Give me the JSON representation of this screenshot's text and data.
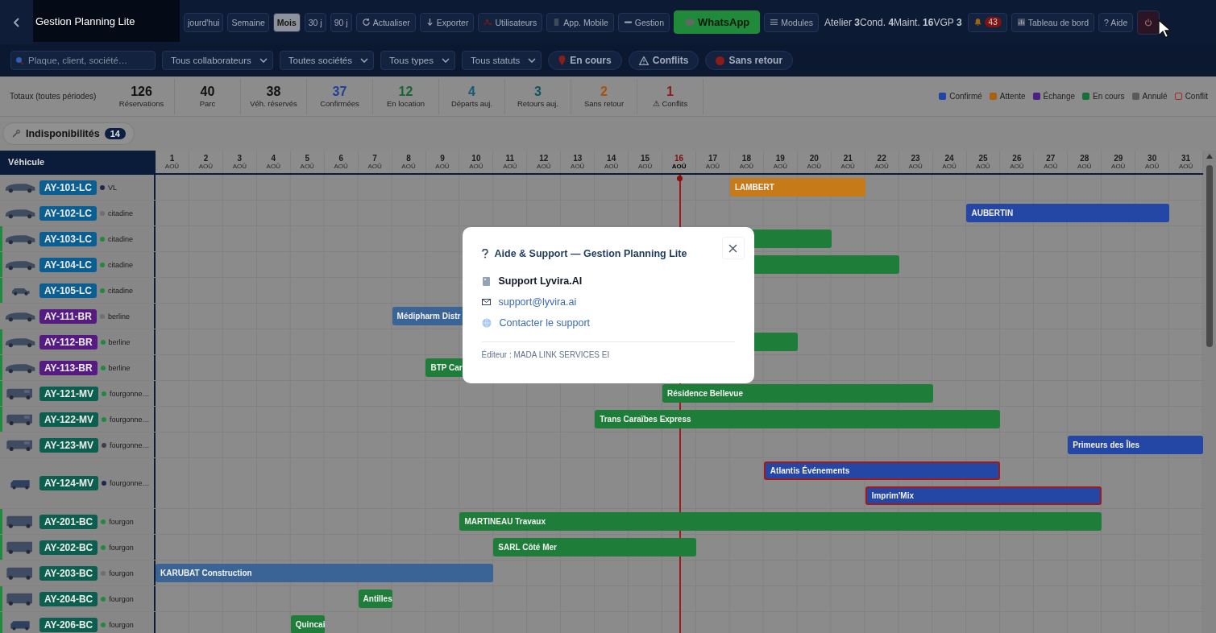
{
  "app": {
    "title": "Gestion Planning Lite"
  },
  "toolbar": {
    "views": [
      {
        "label": "jourd'hui",
        "selected": false
      },
      {
        "label": "Semaine",
        "selected": false
      },
      {
        "label": "Mois",
        "selected": true
      },
      {
        "label": "30 j",
        "selected": false
      },
      {
        "label": "90 j",
        "selected": false
      }
    ],
    "actions": [
      {
        "kind": "refresh",
        "label": "Actualiser"
      },
      {
        "kind": "export",
        "label": "Exporter"
      },
      {
        "kind": "users",
        "label": "Utilisateurs"
      },
      {
        "kind": "mobile",
        "label": "App. Mobile"
      },
      {
        "kind": "manage",
        "label": "Gestion"
      },
      {
        "kind": "whatsapp",
        "label": "WhatsApp"
      },
      {
        "kind": "modules",
        "label": "Modules"
      }
    ],
    "counters": "Atelier **3**Cond. **4**Maint. **16**VGP **3**",
    "alerts": {
      "count": "43"
    },
    "dashboard": "Tableau de bord",
    "help": "? Aide"
  },
  "filters": {
    "search": {
      "placeholder": "Plaque, client, société…"
    },
    "selects": [
      "Tous collaborateurs",
      "Toutes sociétés",
      "Tous types",
      "Tous statuts"
    ],
    "chips": [
      {
        "kind": "pin",
        "label": "En cours"
      },
      {
        "kind": "warning",
        "label": "Conflits"
      },
      {
        "kind": "dot",
        "label": "Sans retour"
      }
    ]
  },
  "totals": {
    "label": "Totaux (toutes périodes)",
    "stats": [
      {
        "value": "126",
        "label": "Réservations",
        "color": "#111111"
      },
      {
        "value": "40",
        "label": "Parc",
        "color": "#111111"
      },
      {
        "value": "38",
        "label": "Véh. réservés",
        "color": "#111111"
      },
      {
        "value": "37",
        "label": "Confirmées",
        "color": "#1f3f9a"
      },
      {
        "value": "12",
        "label": "En location",
        "color": "#17662f"
      },
      {
        "value": "4",
        "label": "Départs auj.",
        "color": "#135a75"
      },
      {
        "value": "3",
        "label": "Retours auj.",
        "color": "#0d5660"
      },
      {
        "value": "2",
        "label": "Sans retour",
        "color": "#a8510e"
      },
      {
        "value": "1",
        "label": "⚠ Conflits",
        "color": "#8e1b1b"
      }
    ],
    "legend": [
      {
        "kind": "fill",
        "label": "Confirmé",
        "color": "#1f45a8"
      },
      {
        "kind": "fill",
        "label": "Attente",
        "color": "#a9610b"
      },
      {
        "kind": "fill",
        "label": "Échange",
        "color": "#4c1f86"
      },
      {
        "kind": "fill",
        "label": "En cours",
        "color": "#17703a"
      },
      {
        "kind": "fill",
        "label": "Annulé",
        "color": "#5a5a5a"
      },
      {
        "kind": "outline",
        "label": "Conflit",
        "color": "#a12a2a"
      }
    ]
  },
  "unavailability": {
    "label": "Indisponibilités",
    "count": "14"
  },
  "planning": {
    "header": "Véhicule",
    "days": [
      {
        "day": "1",
        "month": "AOÛ",
        "today": false
      },
      {
        "day": "2",
        "month": "AOÛ",
        "today": false
      },
      {
        "day": "3",
        "month": "AOÛ",
        "today": false
      },
      {
        "day": "4",
        "month": "AOÛ",
        "today": false
      },
      {
        "day": "5",
        "month": "AOÛ",
        "today": false
      },
      {
        "day": "6",
        "month": "AOÛ",
        "today": false
      },
      {
        "day": "7",
        "month": "AOÛ",
        "today": false
      },
      {
        "day": "8",
        "month": "AOÛ",
        "today": false
      },
      {
        "day": "9",
        "month": "AOÛ",
        "today": false
      },
      {
        "day": "10",
        "month": "AOÛ",
        "today": false
      },
      {
        "day": "11",
        "month": "AOÛ",
        "today": false
      },
      {
        "day": "12",
        "month": "AOÛ",
        "today": false
      },
      {
        "day": "13",
        "month": "AOÛ",
        "today": false
      },
      {
        "day": "14",
        "month": "AOÛ",
        "today": false
      },
      {
        "day": "15",
        "month": "AOÛ",
        "today": false
      },
      {
        "day": "16",
        "month": "AOÛ",
        "today": true
      },
      {
        "day": "17",
        "month": "AOÛ",
        "today": false
      },
      {
        "day": "18",
        "month": "AOÛ",
        "today": false
      },
      {
        "day": "19",
        "month": "AOÛ",
        "today": false
      },
      {
        "day": "20",
        "month": "AOÛ",
        "today": false
      },
      {
        "day": "21",
        "month": "AOÛ",
        "today": false
      },
      {
        "day": "22",
        "month": "AOÛ",
        "today": false
      },
      {
        "day": "23",
        "month": "AOÛ",
        "today": false
      },
      {
        "day": "24",
        "month": "AOÛ",
        "today": false
      },
      {
        "day": "25",
        "month": "AOÛ",
        "today": false
      },
      {
        "day": "26",
        "month": "AOÛ",
        "today": false
      },
      {
        "day": "27",
        "month": "AOÛ",
        "today": false
      },
      {
        "day": "28",
        "month": "AOÛ",
        "today": false
      },
      {
        "day": "29",
        "month": "AOÛ",
        "today": false
      },
      {
        "day": "30",
        "month": "AOÛ",
        "today": false
      },
      {
        "day": "31",
        "month": "AOÛ",
        "today": false
      }
    ],
    "vehicles": [
      {
        "kind": "car",
        "plate": {
          "label": "AY-101-LC",
          "color": "#0b5e92"
        },
        "dot": {
          "color": "#1b2a4a"
        },
        "in_use": false,
        "type": "VL",
        "lanes": [
          [
            {
              "label": "LAMBERT",
              "color": "#c67a18",
              "conflict": false
            }
          ]
        ]
      },
      {
        "kind": "car",
        "plate": {
          "label": "AY-102-LC",
          "color": "#0b5e92"
        },
        "dot": {
          "color": "#6f6f6f"
        },
        "in_use": false,
        "type": "citadine",
        "lanes": [
          [
            {
              "label": "AUBERTIN",
              "color": "#2447a6",
              "conflict": false
            }
          ]
        ]
      },
      {
        "kind": "car",
        "plate": {
          "label": "AY-103-LC",
          "color": "#0b5e92"
        },
        "dot": {
          "color": "#1e8a3c"
        },
        "in_use": true,
        "type": "citadine",
        "lanes": [
          [
            {
              "color": "#1f7d3a",
              "conflict": false
            }
          ]
        ]
      },
      {
        "kind": "car",
        "plate": {
          "label": "AY-104-LC",
          "color": "#0b5e92"
        },
        "dot": {
          "color": "#1e8a3c"
        },
        "in_use": true,
        "type": "citadine",
        "lanes": [
          [
            {
              "color": "#1f7d3a",
              "conflict": false
            }
          ]
        ]
      },
      {
        "kind": "small-car",
        "plate": {
          "label": "AY-105-LC",
          "color": "#0b5e92"
        },
        "dot": {
          "color": "#1e8a3c"
        },
        "in_use": true,
        "type": "citadine"
      },
      {
        "kind": "car",
        "plate": {
          "label": "AY-111-BR",
          "color": "#561b82"
        },
        "dot": {
          "color": "#6f6f6f"
        },
        "in_use": false,
        "type": "berline",
        "lanes": [
          [
            {
              "label": "Médipharm Distr",
              "color": "#3a6396",
              "conflict": false
            }
          ]
        ]
      },
      {
        "kind": "car",
        "plate": {
          "label": "AY-112-BR",
          "color": "#561b82"
        },
        "dot": {
          "color": "#1e8a3c"
        },
        "in_use": true,
        "type": "berline",
        "lanes": [
          [
            {
              "color": "#1f7d3a",
              "conflict": false
            }
          ]
        ]
      },
      {
        "kind": "car",
        "plate": {
          "label": "AY-113-BR",
          "color": "#561b82"
        },
        "dot": {
          "color": "#1e8a3c"
        },
        "in_use": true,
        "type": "berline",
        "lanes": [
          [
            {
              "label": "BTP Car",
              "color": "#1f7d3a",
              "conflict": false
            }
          ]
        ]
      },
      {
        "kind": "van",
        "plate": {
          "label": "AY-121-MV",
          "color": "#0c5f4f"
        },
        "dot": {
          "color": "#1e8a3c"
        },
        "in_use": true,
        "type": "fourgonne…",
        "lanes": [
          [
            {
              "label": "Résidence Bellevue",
              "color": "#1f7d3a",
              "conflict": false
            }
          ]
        ]
      },
      {
        "kind": "van",
        "plate": {
          "label": "AY-122-MV",
          "color": "#0c5f4f"
        },
        "dot": {
          "color": "#1e8a3c"
        },
        "in_use": true,
        "type": "fourgonne…",
        "lanes": [
          [
            {
              "label": "Trans Caraïbes Express",
              "color": "#1f7d3a",
              "conflict": false
            }
          ]
        ]
      },
      {
        "kind": "van",
        "plate": {
          "label": "AY-123-MV",
          "color": "#0c5f4f"
        },
        "dot": {
          "color": "#3a3f4a"
        },
        "in_use": false,
        "type": "fourgonne…",
        "lanes": [
          [
            {
              "label": "Primeurs des Îles",
              "color": "#2447a6",
              "conflict": false
            }
          ]
        ]
      },
      {
        "kind": "small-van",
        "plate": {
          "label": "AY-124-MV",
          "color": "#0c5f4f"
        },
        "dot": {
          "color": "#1b2a4a"
        },
        "in_use": false,
        "type": "fourgonne…",
        "lanes": [
          [
            {
              "label": "Atlantis Événements",
              "color": "#2447a6",
              "conflict": true
            }
          ],
          [
            {
              "label": "Imprim'Mix",
              "color": "#2447a6",
              "conflict": true
            }
          ]
        ]
      },
      {
        "kind": "truck",
        "plate": {
          "label": "AY-201-BC",
          "color": "#0c5f4f"
        },
        "dot": {
          "color": "#1e8a3c"
        },
        "in_use": true,
        "type": "fourgon",
        "lanes": [
          [
            {
              "label": "MARTINEAU Travaux",
              "color": "#1f7d3a",
              "conflict": false
            }
          ]
        ]
      },
      {
        "kind": "truck",
        "plate": {
          "label": "AY-202-BC",
          "color": "#0c5f4f"
        },
        "dot": {
          "color": "#1e8a3c"
        },
        "in_use": true,
        "type": "fourgon",
        "lanes": [
          [
            {
              "label": "SARL Côté Mer",
              "color": "#1f7d3a",
              "conflict": false
            }
          ]
        ]
      },
      {
        "kind": "truck",
        "plate": {
          "label": "AY-203-BC",
          "color": "#0c5f4f"
        },
        "dot": {
          "color": "#6f6f6f"
        },
        "in_use": false,
        "type": "fourgon",
        "lanes": [
          [
            {
              "label": "KARUBAT Construction",
              "color": "#3a6396",
              "conflict": false
            }
          ]
        ]
      },
      {
        "kind": "truck",
        "plate": {
          "label": "AY-204-BC",
          "color": "#0c5f4f"
        },
        "dot": {
          "color": "#1e8a3c"
        },
        "in_use": true,
        "type": "fourgon",
        "lanes": [
          [
            {
              "label": "Antilles",
              "color": "#1f7d3a",
              "conflict": false
            }
          ]
        ]
      },
      {
        "kind": "small-van",
        "plate": {
          "label": "AY-206-BC",
          "color": "#0c5f4f"
        },
        "dot": {
          "color": "#1e8a3c"
        },
        "in_use": true,
        "type": "fourgon",
        "lanes": [
          [
            {
              "label": "Quincai",
              "color": "#1f7d3a",
              "conflict": false
            }
          ]
        ]
      }
    ]
  },
  "dialog": {
    "title": "Aide & Support — Gestion Planning Lite",
    "company": "Support Lyvira.AI",
    "email": "support@lyvira.ai",
    "contact": "Contacter le support",
    "publisher": "Éditeur : MADA LINK SERVICES EI"
  }
}
